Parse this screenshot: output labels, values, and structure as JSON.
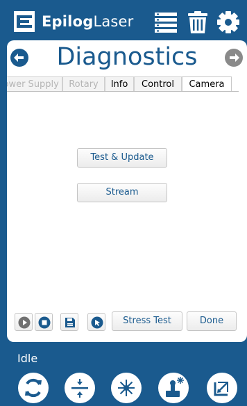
{
  "header": {
    "logo_bold": "Epilog",
    "logo_light": "Laser"
  },
  "page": {
    "title": "Diagnostics"
  },
  "tabs": [
    {
      "label": "Power Supply",
      "state": "disabled"
    },
    {
      "label": "Rotary",
      "state": "disabled"
    },
    {
      "label": "Info",
      "state": "normal"
    },
    {
      "label": "Control",
      "state": "normal"
    },
    {
      "label": "Camera",
      "state": "active"
    }
  ],
  "camera": {
    "test_update_label": "Test & Update",
    "stream_label": "Stream"
  },
  "toolbar": {
    "stress_test_label": "Stress Test",
    "done_label": "Done"
  },
  "status": {
    "text": "Idle"
  },
  "colors": {
    "brand_blue": "#1a5a8e",
    "nav_gray": "#8a8a8a"
  },
  "icons": {
    "header": [
      "epilog-logo-icon",
      "job-list-icon",
      "trash-icon",
      "gear-icon"
    ],
    "footer": [
      "refresh-icon",
      "focus-icon",
      "laser-icon",
      "jog-icon",
      "home-icon"
    ]
  }
}
